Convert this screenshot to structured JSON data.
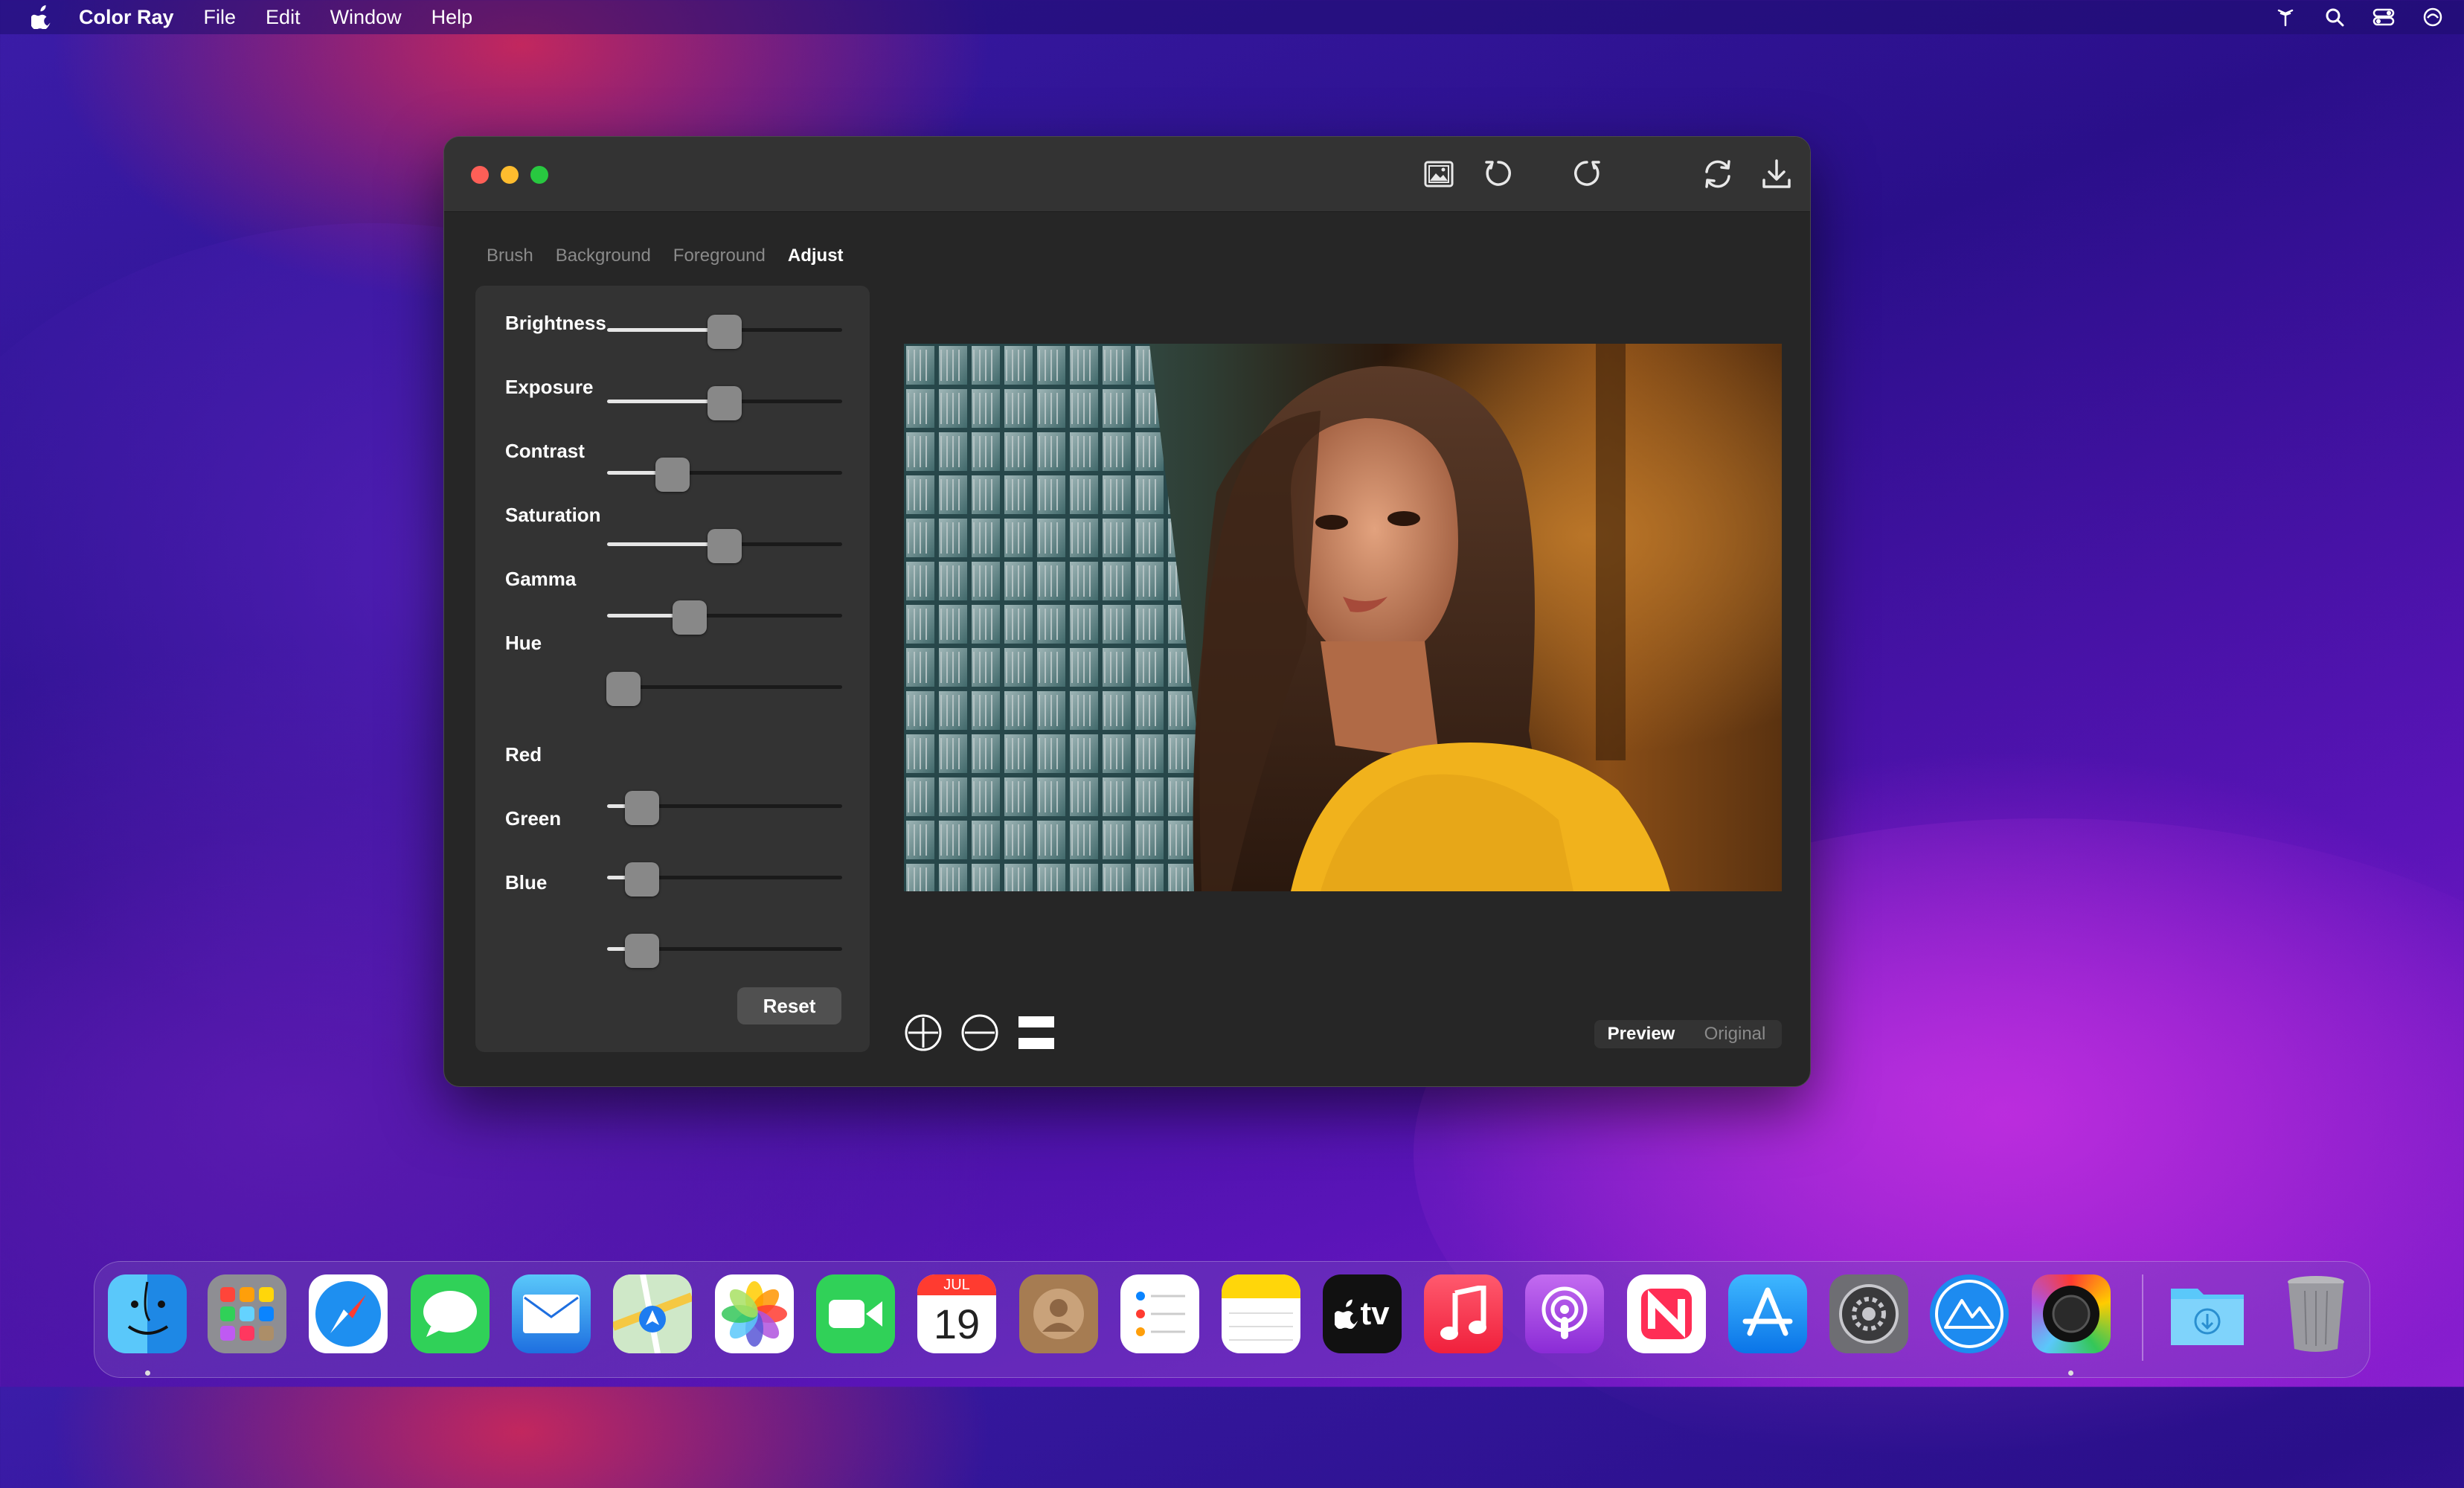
{
  "menubar": {
    "app_name": "Color Ray",
    "items": [
      "File",
      "Edit",
      "Window",
      "Help"
    ],
    "status_icons": [
      "wifi-icon",
      "search-icon",
      "control-center-icon",
      "siri-icon"
    ]
  },
  "window": {
    "toolbar_icons": [
      "image-icon",
      "rotate-left-icon",
      "rotate-right-icon",
      "refresh-icon",
      "download-icon"
    ],
    "tabs": [
      "Brush",
      "Background",
      "Foreground",
      "Adjust"
    ],
    "active_tab": "Adjust",
    "adjust": {
      "labels": {
        "brightness": "Brightness",
        "exposure": "Exposure",
        "contrast": "Contrast",
        "saturation": "Saturation",
        "gamma": "Gamma",
        "hue": "Hue",
        "red": "Red",
        "green": "Green",
        "blue": "Blue"
      },
      "slider_values": [
        0.5,
        0.5,
        0.28,
        0.5,
        0.35,
        0.07,
        0.15,
        0.15,
        0.15
      ],
      "reset_label": "Reset"
    },
    "view_toggle": {
      "preview": "Preview",
      "original": "Original",
      "active": "Preview"
    },
    "bottom_icons": [
      "zoom-in-icon",
      "zoom-out-icon",
      "split-view-icon"
    ]
  },
  "dock": {
    "apps": [
      "Finder",
      "Launchpad",
      "Safari",
      "Messages",
      "Mail",
      "Maps",
      "Photos",
      "FaceTime",
      "Calendar",
      "Contacts",
      "Reminders",
      "Notes",
      "TV",
      "Music",
      "Podcasts",
      "News",
      "App Store",
      "System Preferences",
      "Altitude",
      "Color Ray",
      "Downloads",
      "Trash"
    ],
    "calendar": {
      "month": "JUL",
      "day": "19"
    },
    "tv_label": "tv",
    "running": [
      "Finder",
      "Color Ray"
    ]
  }
}
